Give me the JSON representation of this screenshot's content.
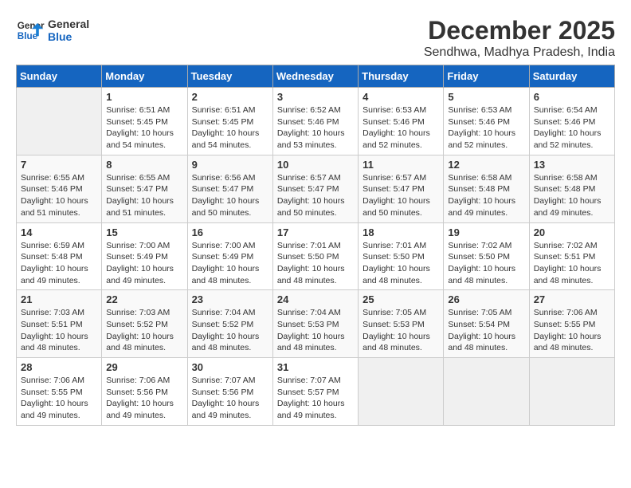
{
  "logo": {
    "line1": "General",
    "line2": "Blue"
  },
  "title": "December 2025",
  "subtitle": "Sendhwa, Madhya Pradesh, India",
  "days_of_week": [
    "Sunday",
    "Monday",
    "Tuesday",
    "Wednesday",
    "Thursday",
    "Friday",
    "Saturday"
  ],
  "weeks": [
    [
      {
        "num": "",
        "empty": true
      },
      {
        "num": "1",
        "sunrise": "6:51 AM",
        "sunset": "5:45 PM",
        "daylight": "10 hours and 54 minutes."
      },
      {
        "num": "2",
        "sunrise": "6:51 AM",
        "sunset": "5:45 PM",
        "daylight": "10 hours and 54 minutes."
      },
      {
        "num": "3",
        "sunrise": "6:52 AM",
        "sunset": "5:46 PM",
        "daylight": "10 hours and 53 minutes."
      },
      {
        "num": "4",
        "sunrise": "6:53 AM",
        "sunset": "5:46 PM",
        "daylight": "10 hours and 52 minutes."
      },
      {
        "num": "5",
        "sunrise": "6:53 AM",
        "sunset": "5:46 PM",
        "daylight": "10 hours and 52 minutes."
      },
      {
        "num": "6",
        "sunrise": "6:54 AM",
        "sunset": "5:46 PM",
        "daylight": "10 hours and 52 minutes."
      }
    ],
    [
      {
        "num": "7",
        "sunrise": "6:55 AM",
        "sunset": "5:46 PM",
        "daylight": "10 hours and 51 minutes."
      },
      {
        "num": "8",
        "sunrise": "6:55 AM",
        "sunset": "5:47 PM",
        "daylight": "10 hours and 51 minutes."
      },
      {
        "num": "9",
        "sunrise": "6:56 AM",
        "sunset": "5:47 PM",
        "daylight": "10 hours and 50 minutes."
      },
      {
        "num": "10",
        "sunrise": "6:57 AM",
        "sunset": "5:47 PM",
        "daylight": "10 hours and 50 minutes."
      },
      {
        "num": "11",
        "sunrise": "6:57 AM",
        "sunset": "5:47 PM",
        "daylight": "10 hours and 50 minutes."
      },
      {
        "num": "12",
        "sunrise": "6:58 AM",
        "sunset": "5:48 PM",
        "daylight": "10 hours and 49 minutes."
      },
      {
        "num": "13",
        "sunrise": "6:58 AM",
        "sunset": "5:48 PM",
        "daylight": "10 hours and 49 minutes."
      }
    ],
    [
      {
        "num": "14",
        "sunrise": "6:59 AM",
        "sunset": "5:48 PM",
        "daylight": "10 hours and 49 minutes."
      },
      {
        "num": "15",
        "sunrise": "7:00 AM",
        "sunset": "5:49 PM",
        "daylight": "10 hours and 49 minutes."
      },
      {
        "num": "16",
        "sunrise": "7:00 AM",
        "sunset": "5:49 PM",
        "daylight": "10 hours and 48 minutes."
      },
      {
        "num": "17",
        "sunrise": "7:01 AM",
        "sunset": "5:50 PM",
        "daylight": "10 hours and 48 minutes."
      },
      {
        "num": "18",
        "sunrise": "7:01 AM",
        "sunset": "5:50 PM",
        "daylight": "10 hours and 48 minutes."
      },
      {
        "num": "19",
        "sunrise": "7:02 AM",
        "sunset": "5:50 PM",
        "daylight": "10 hours and 48 minutes."
      },
      {
        "num": "20",
        "sunrise": "7:02 AM",
        "sunset": "5:51 PM",
        "daylight": "10 hours and 48 minutes."
      }
    ],
    [
      {
        "num": "21",
        "sunrise": "7:03 AM",
        "sunset": "5:51 PM",
        "daylight": "10 hours and 48 minutes."
      },
      {
        "num": "22",
        "sunrise": "7:03 AM",
        "sunset": "5:52 PM",
        "daylight": "10 hours and 48 minutes."
      },
      {
        "num": "23",
        "sunrise": "7:04 AM",
        "sunset": "5:52 PM",
        "daylight": "10 hours and 48 minutes."
      },
      {
        "num": "24",
        "sunrise": "7:04 AM",
        "sunset": "5:53 PM",
        "daylight": "10 hours and 48 minutes."
      },
      {
        "num": "25",
        "sunrise": "7:05 AM",
        "sunset": "5:53 PM",
        "daylight": "10 hours and 48 minutes."
      },
      {
        "num": "26",
        "sunrise": "7:05 AM",
        "sunset": "5:54 PM",
        "daylight": "10 hours and 48 minutes."
      },
      {
        "num": "27",
        "sunrise": "7:06 AM",
        "sunset": "5:55 PM",
        "daylight": "10 hours and 48 minutes."
      }
    ],
    [
      {
        "num": "28",
        "sunrise": "7:06 AM",
        "sunset": "5:55 PM",
        "daylight": "10 hours and 49 minutes."
      },
      {
        "num": "29",
        "sunrise": "7:06 AM",
        "sunset": "5:56 PM",
        "daylight": "10 hours and 49 minutes."
      },
      {
        "num": "30",
        "sunrise": "7:07 AM",
        "sunset": "5:56 PM",
        "daylight": "10 hours and 49 minutes."
      },
      {
        "num": "31",
        "sunrise": "7:07 AM",
        "sunset": "5:57 PM",
        "daylight": "10 hours and 49 minutes."
      },
      {
        "num": "",
        "empty": true
      },
      {
        "num": "",
        "empty": true
      },
      {
        "num": "",
        "empty": true
      }
    ]
  ]
}
